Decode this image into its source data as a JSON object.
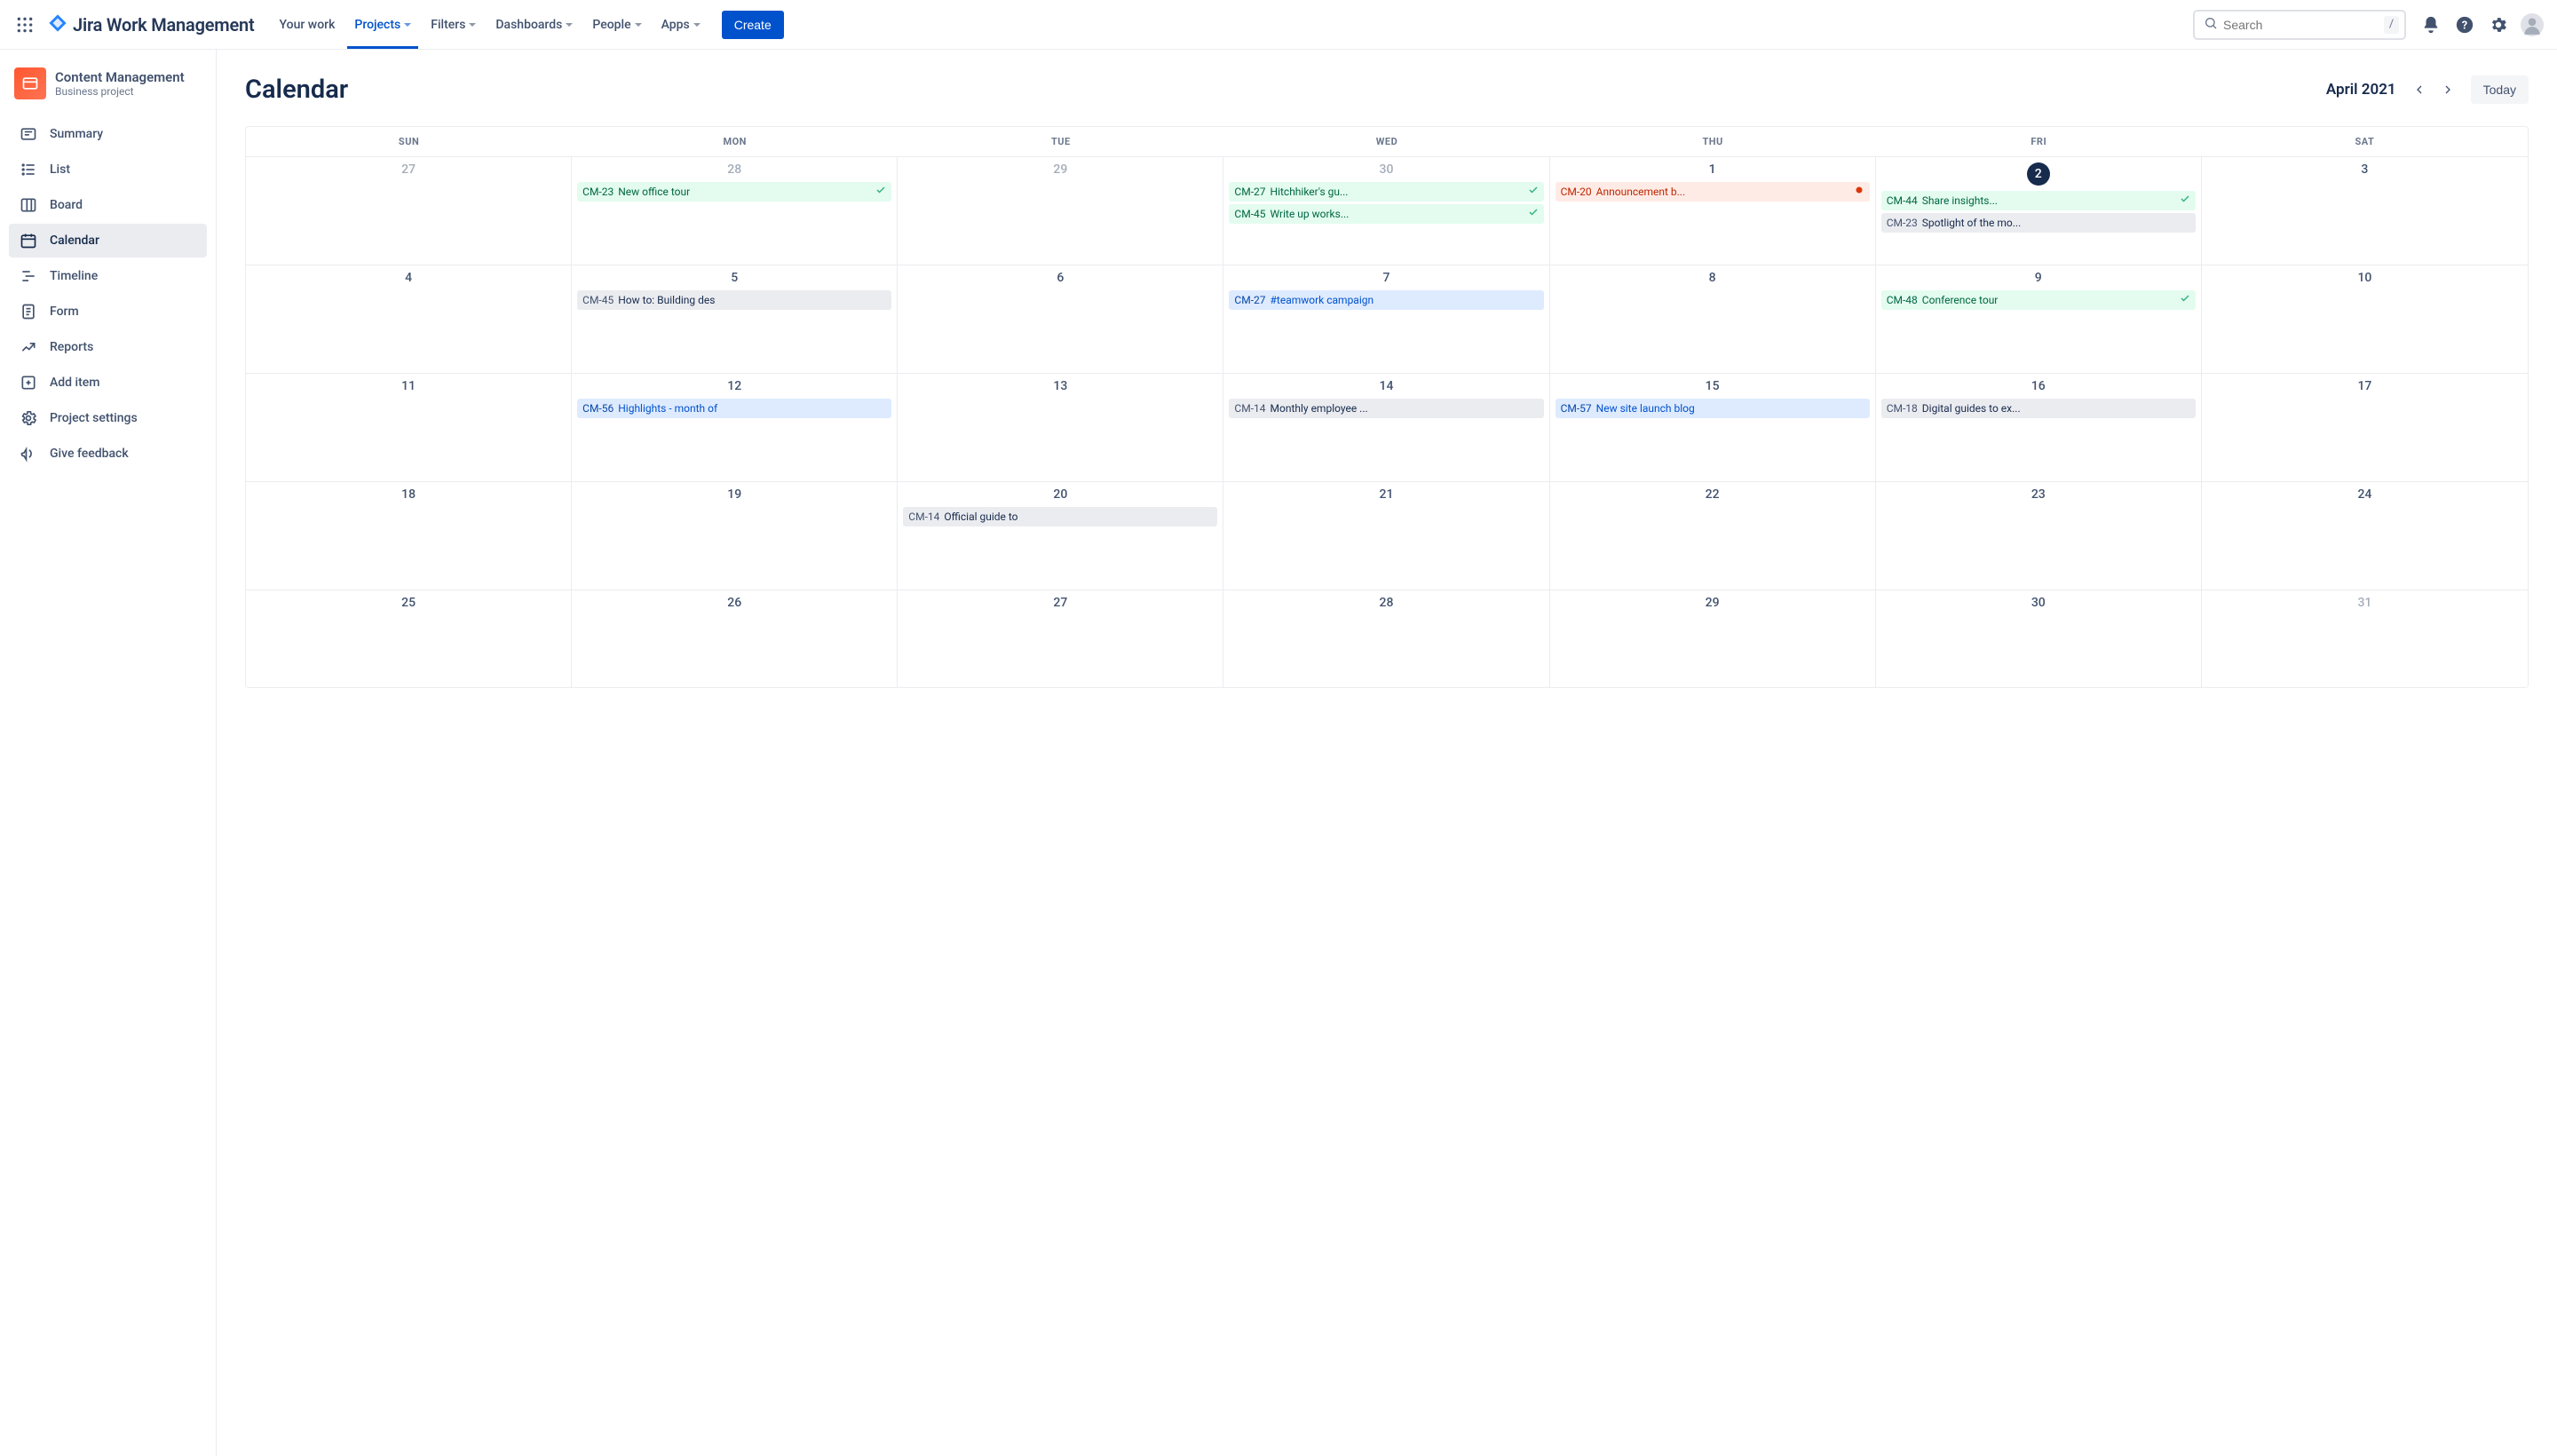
{
  "brand": {
    "name": "Jira Work Management"
  },
  "topnav": {
    "your_work": "Your work",
    "projects": "Projects",
    "filters": "Filters",
    "dashboards": "Dashboards",
    "people": "People",
    "apps": "Apps",
    "create": "Create"
  },
  "search": {
    "placeholder": "Search",
    "kbd": "/"
  },
  "project": {
    "name": "Content Management",
    "subtitle": "Business project"
  },
  "sidebar": {
    "summary": "Summary",
    "list": "List",
    "board": "Board",
    "calendar": "Calendar",
    "timeline": "Timeline",
    "form": "Form",
    "reports": "Reports",
    "add_item": "Add item",
    "project_settings": "Project settings",
    "give_feedback": "Give feedback"
  },
  "page": {
    "title": "Calendar"
  },
  "calendar": {
    "month_label": "April 2021",
    "today_btn": "Today",
    "dow": [
      "SUN",
      "MON",
      "TUE",
      "WED",
      "THU",
      "FRI",
      "SAT"
    ],
    "weeks": [
      {
        "days": [
          {
            "n": "27",
            "other": true,
            "events": []
          },
          {
            "n": "28",
            "other": true,
            "events": [
              {
                "key": "CM-23",
                "txt": "New office tour",
                "color": "green",
                "check": true
              }
            ]
          },
          {
            "n": "29",
            "other": true,
            "events": []
          },
          {
            "n": "30",
            "other": true,
            "events": [
              {
                "key": "CM-27",
                "txt": "Hitchhiker's gu...",
                "color": "green",
                "check": true
              },
              {
                "key": "CM-45",
                "txt": "Write up works...",
                "color": "green",
                "check": true
              }
            ]
          },
          {
            "n": "1",
            "events": [
              {
                "key": "CM-20",
                "txt": "Announcement b...",
                "color": "red",
                "dot": true
              }
            ]
          },
          {
            "n": "2",
            "today": true,
            "events": [
              {
                "key": "CM-44",
                "txt": "Share insights...",
                "color": "green",
                "check": true
              },
              {
                "key": "CM-23",
                "txt": "Spotlight of the mo...",
                "color": "grey"
              }
            ]
          },
          {
            "n": "3",
            "events": []
          }
        ]
      },
      {
        "days": [
          {
            "n": "4",
            "events": []
          },
          {
            "n": "5",
            "events": [
              {
                "key": "CM-45",
                "txt": "How to: Building des",
                "color": "grey"
              }
            ]
          },
          {
            "n": "6",
            "events": []
          },
          {
            "n": "7",
            "events": [
              {
                "key": "CM-27",
                "txt": "#teamwork campaign",
                "color": "blue"
              }
            ]
          },
          {
            "n": "8",
            "events": []
          },
          {
            "n": "9",
            "events": [
              {
                "key": "CM-48",
                "txt": "Conference tour",
                "color": "green",
                "check": true
              }
            ]
          },
          {
            "n": "10",
            "events": []
          }
        ]
      },
      {
        "days": [
          {
            "n": "11",
            "events": []
          },
          {
            "n": "12",
            "events": [
              {
                "key": "CM-56",
                "txt": "Highlights - month of",
                "color": "blue"
              }
            ]
          },
          {
            "n": "13",
            "events": []
          },
          {
            "n": "14",
            "events": [
              {
                "key": "CM-14",
                "txt": "Monthly employee ...",
                "color": "grey"
              }
            ]
          },
          {
            "n": "15",
            "events": [
              {
                "key": "CM-57",
                "txt": "New site launch blog",
                "color": "blue"
              }
            ]
          },
          {
            "n": "16",
            "events": [
              {
                "key": "CM-18",
                "txt": "Digital guides to ex...",
                "color": "grey"
              }
            ]
          },
          {
            "n": "17",
            "events": []
          }
        ]
      },
      {
        "days": [
          {
            "n": "18",
            "events": []
          },
          {
            "n": "19",
            "events": []
          },
          {
            "n": "20",
            "events": [
              {
                "key": "CM-14",
                "txt": "Official guide to",
                "color": "grey"
              }
            ]
          },
          {
            "n": "21",
            "events": []
          },
          {
            "n": "22",
            "events": []
          },
          {
            "n": "23",
            "events": []
          },
          {
            "n": "24",
            "events": []
          }
        ]
      },
      {
        "days": [
          {
            "n": "25",
            "events": []
          },
          {
            "n": "26",
            "events": []
          },
          {
            "n": "27",
            "events": []
          },
          {
            "n": "28",
            "events": []
          },
          {
            "n": "29",
            "events": []
          },
          {
            "n": "30",
            "events": []
          },
          {
            "n": "31",
            "other": true,
            "events": []
          }
        ],
        "short": true
      }
    ]
  }
}
